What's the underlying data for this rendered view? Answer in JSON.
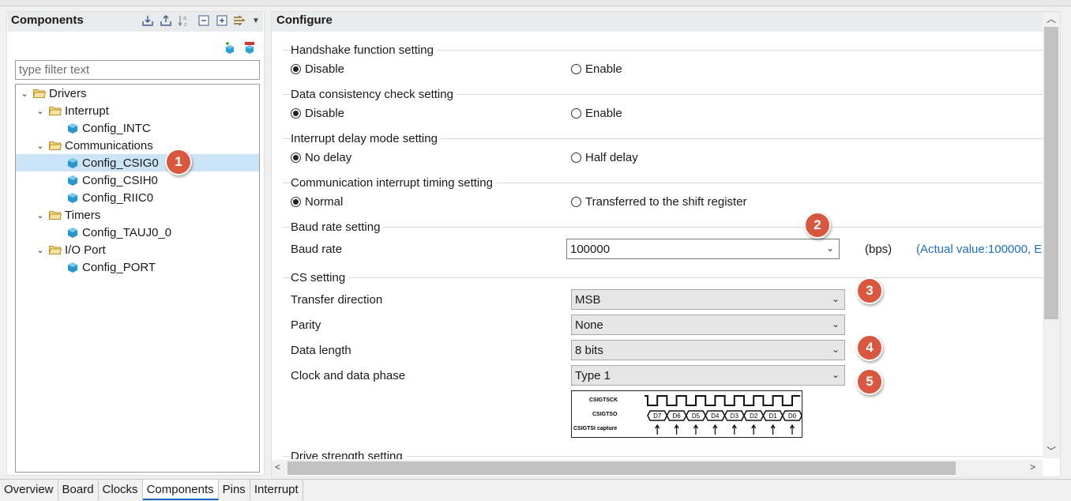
{
  "components_panel": {
    "title": "Components",
    "filter_placeholder": "type filter text",
    "tree": [
      {
        "label": "Drivers",
        "kind": "folder"
      },
      {
        "label": "Interrupt",
        "kind": "folder"
      },
      {
        "label": "Config_INTC",
        "kind": "component"
      },
      {
        "label": "Communications",
        "kind": "folder"
      },
      {
        "label": "Config_CSIG0",
        "kind": "component",
        "selected": true
      },
      {
        "label": "Config_CSIH0",
        "kind": "component"
      },
      {
        "label": "Config_RIIC0",
        "kind": "component"
      },
      {
        "label": "Timers",
        "kind": "folder"
      },
      {
        "label": "Config_TAUJ0_0",
        "kind": "component"
      },
      {
        "label": "I/O Port",
        "kind": "folder"
      },
      {
        "label": "Config_PORT",
        "kind": "component"
      }
    ]
  },
  "configure_panel": {
    "title": "Configure",
    "handshake": {
      "title": "Handshake function setting",
      "opt1": "Disable",
      "opt2": "Enable"
    },
    "consistency": {
      "title": "Data consistency check setting",
      "opt1": "Disable",
      "opt2": "Enable"
    },
    "delay": {
      "title": "Interrupt delay mode setting",
      "opt1": "No delay",
      "opt2": "Half delay"
    },
    "timing": {
      "title": "Communication interrupt timing setting",
      "opt1": "Normal",
      "opt2": "Transferred to the shift register"
    },
    "baud": {
      "title": "Baud rate setting",
      "label": "Baud rate",
      "value": "100000",
      "unit": "(bps)",
      "actual": "(Actual value:100000, E"
    },
    "cs": {
      "title": "CS setting",
      "transfer_label": "Transfer direction",
      "transfer_value": "MSB",
      "parity_label": "Parity",
      "parity_value": "None",
      "length_label": "Data length",
      "length_value": "8 bits",
      "phase_label": "Clock and data phase",
      "phase_value": "Type 1"
    },
    "drive": {
      "title": "Drive strength setting"
    },
    "timing_diagram": {
      "sck": "CSIGTSCK",
      "so": "CSIGTSO",
      "si": "CSIGTSI capture",
      "bits": [
        "D7",
        "D6",
        "D5",
        "D4",
        "D3",
        "D2",
        "D1",
        "D0"
      ]
    }
  },
  "badges": [
    "1",
    "2",
    "3",
    "4",
    "5"
  ],
  "bottom_tabs": [
    "Overview",
    "Board",
    "Clocks",
    "Components",
    "Pins",
    "Interrupt"
  ],
  "colors": {
    "badge": "#d9573e",
    "selection": "#cce4f7",
    "link": "#1f6fbf",
    "header": "#e9eaec"
  }
}
